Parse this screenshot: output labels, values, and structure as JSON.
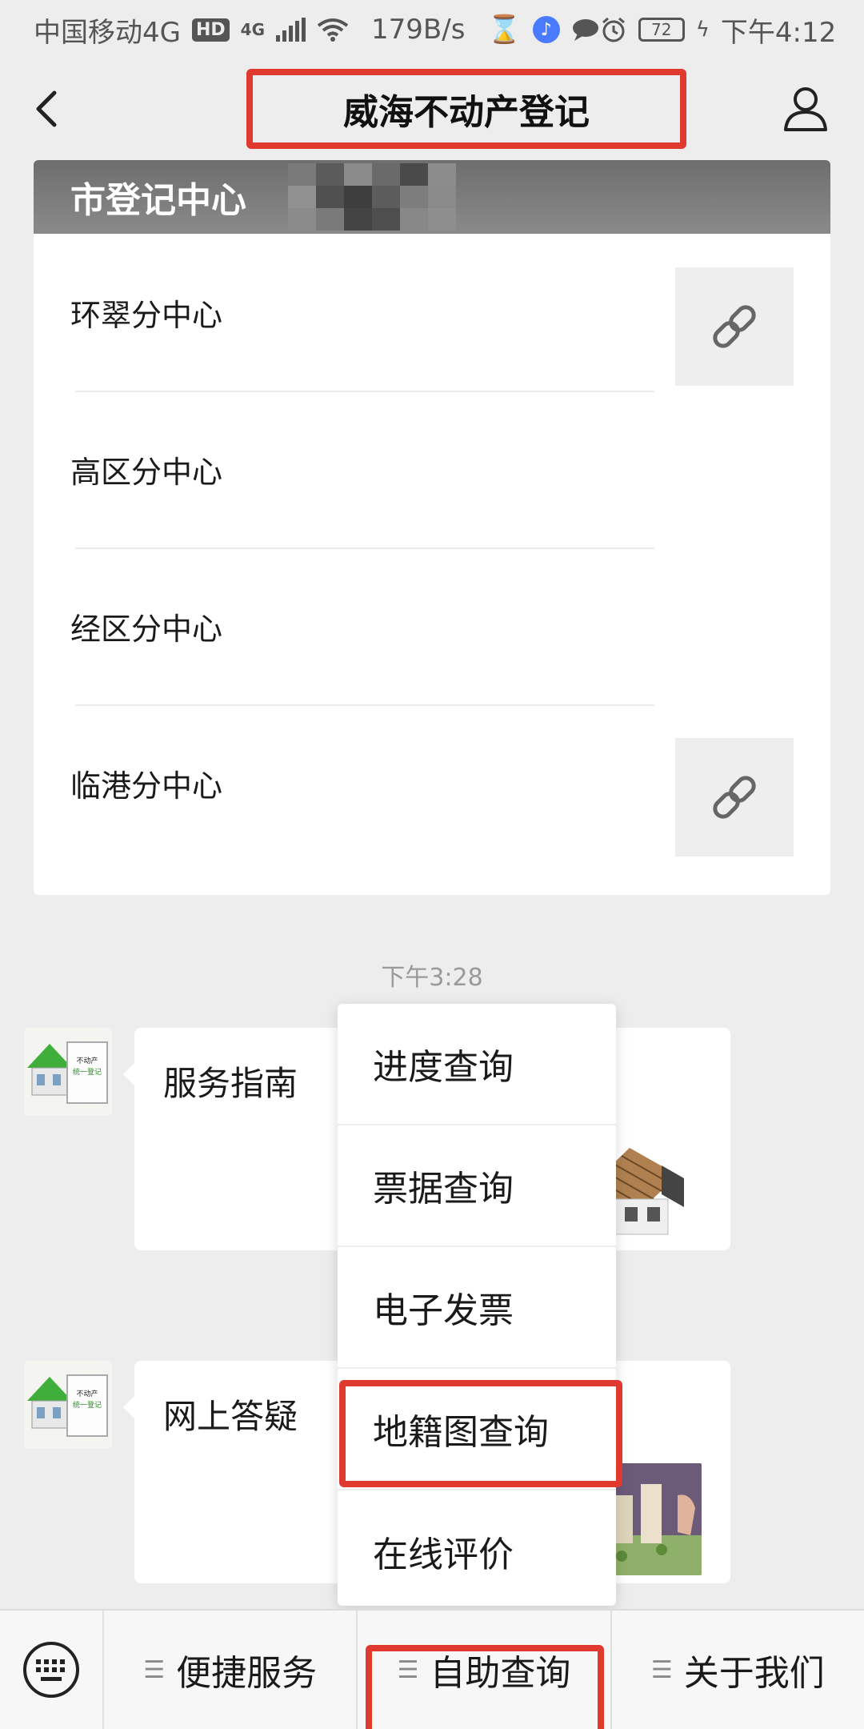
{
  "status_bar": {
    "carrier": "中国移动4G",
    "hd_badge": "HD",
    "network_type": "4G",
    "net_speed": "179B/s",
    "battery_level": "72",
    "time": "下午4:12"
  },
  "nav": {
    "title": "威海不动产登记"
  },
  "article_card": {
    "banner_text": "市登记中心",
    "items": [
      {
        "label": "环翠分中心",
        "has_link_icon": true
      },
      {
        "label": "高区分中心",
        "has_link_icon": false
      },
      {
        "label": "经区分中心",
        "has_link_icon": false
      },
      {
        "label": "临港分中心",
        "has_link_icon": true
      }
    ]
  },
  "timestamp": "下午3:28",
  "messages": [
    {
      "title": "服务指南",
      "avatar_text": [
        "不动产",
        "统一登记"
      ]
    },
    {
      "title": "网上答疑",
      "avatar_text": [
        "不动产",
        "统一登记"
      ]
    }
  ],
  "popup_menu": {
    "items": [
      "进度查询",
      "票据查询",
      "电子发票",
      "地籍图查询",
      "在线评价"
    ],
    "highlighted_index": 3
  },
  "bottom_menu": {
    "items": [
      "便捷服务",
      "自助查询",
      "关于我们"
    ],
    "highlighted_index": 1
  },
  "colors": {
    "highlight_box": "#e03a30",
    "page_background": "#ededed"
  }
}
